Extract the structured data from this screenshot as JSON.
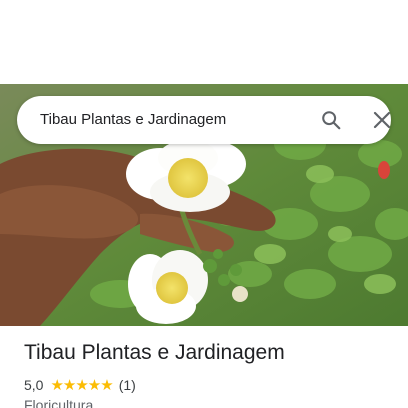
{
  "search": {
    "query": "Tibau Plantas e Jardinagem",
    "search_icon": "search-icon",
    "close_icon": "close-icon"
  },
  "hero": {
    "photo": "place-photo"
  },
  "place": {
    "title": "Tibau Plantas e Jardinagem",
    "rating": "5,0",
    "stars": "★★★★★",
    "stars_value": 5,
    "review_count": "(1)",
    "category": "Floricultura"
  },
  "colors": {
    "star": "#fbbc04",
    "text_primary": "#202124",
    "text_secondary": "#5f6368"
  }
}
